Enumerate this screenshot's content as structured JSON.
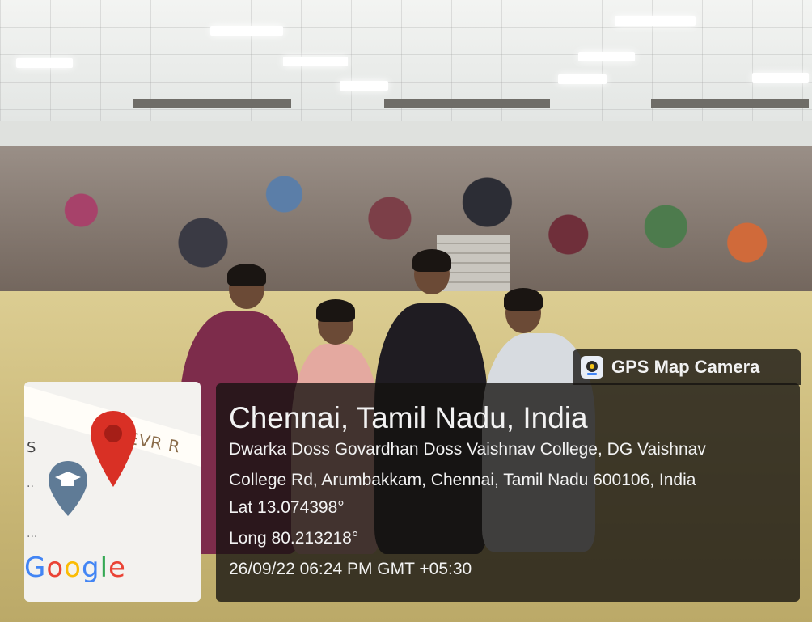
{
  "gps_stamp": {
    "app_name": "GPS Map Camera",
    "city_line": "Chennai, Tamil Nadu, India",
    "address_line1": "Dwarka Doss Govardhan Doss Vaishnav College, DG Vaishnav",
    "address_line2": "College Rd, Arumbakkam, Chennai, Tamil Nadu 600106, India",
    "lat": "Lat 13.074398°",
    "long": "Long 80.213218°",
    "datetime": "26/09/22 06:24 PM GMT +05:30"
  },
  "map_tile": {
    "road_label": "EVR R",
    "left_text": "S",
    "dots": "..",
    "dots2": "...",
    "brand": "Google"
  },
  "icons": {
    "location_pin": "map-pin-icon",
    "college_marker": "graduation-cap-pin-icon",
    "app_icon": "gps-camera-icon"
  },
  "colors": {
    "card_bg": "#141210",
    "pin_red": "#d93025",
    "school_pin": "#5f7b96"
  }
}
